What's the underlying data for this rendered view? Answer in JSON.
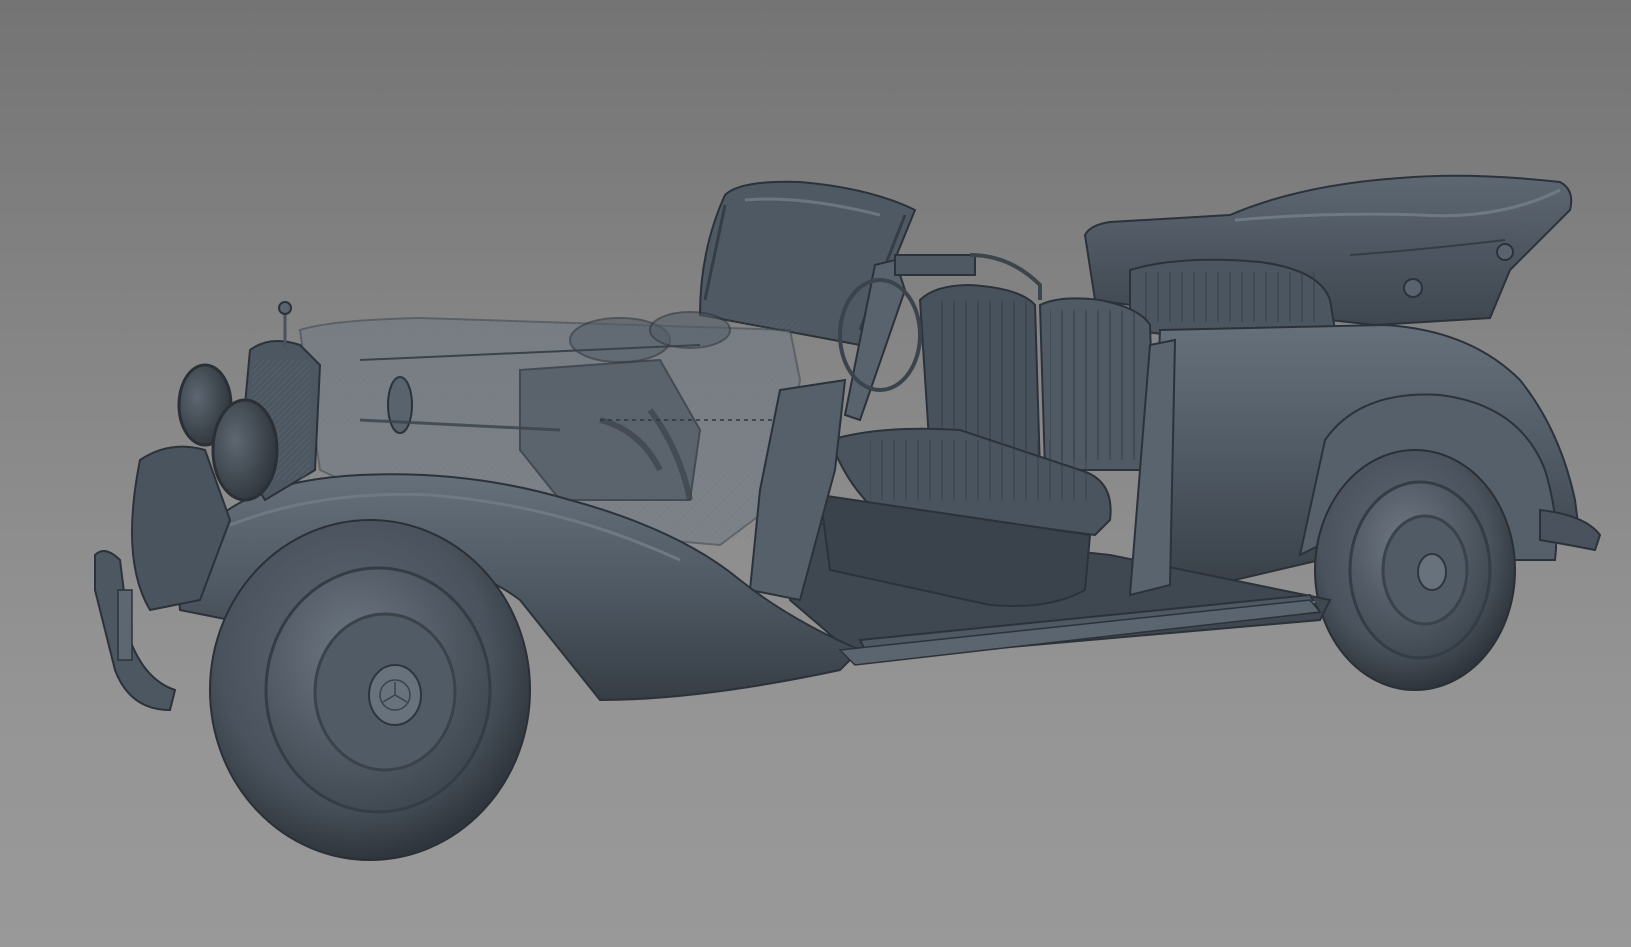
{
  "viewport": {
    "background_top": "#747474",
    "background_bottom": "#999999",
    "model_color": "#4b5560",
    "model_highlight": "#7d8893",
    "model_shadow": "#2c3239"
  },
  "model": {
    "icon": "car-model-icon",
    "badge": "three-pointed-star-icon"
  }
}
